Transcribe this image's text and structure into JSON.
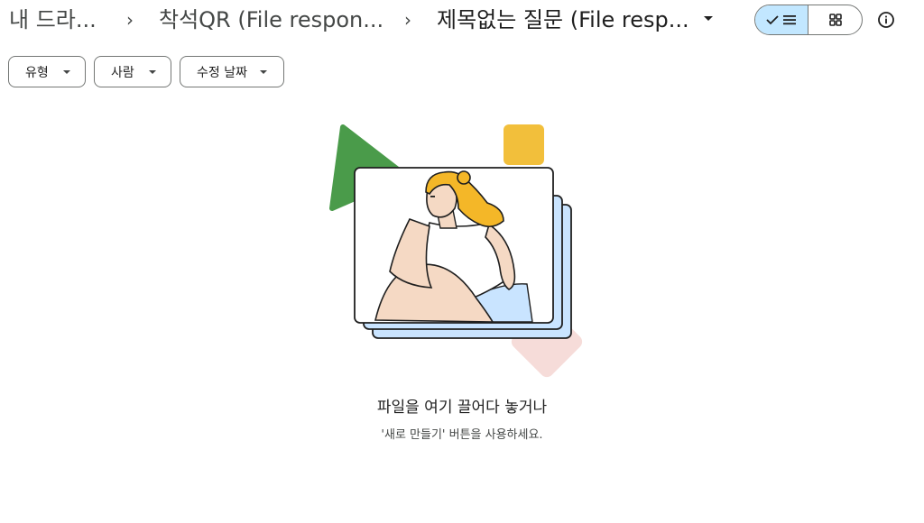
{
  "breadcrumb": {
    "items": [
      "내 드라...",
      "착석QR (File respon...",
      "제목없는 질문 (File resp..."
    ],
    "separator": "›"
  },
  "view_toggle": {
    "active": "list",
    "icons": [
      "check-icon",
      "list-icon",
      "grid-icon"
    ]
  },
  "filters": [
    "유형",
    "사람",
    "수정 날짜"
  ],
  "empty_state": {
    "title": "파일을 여기 끌어다 놓거나",
    "subtitle": "'새로 만들기' 버튼을 사용하세요."
  },
  "colors": {
    "active_segment": "#c2e7ff",
    "green_shape": "#4a9b4a",
    "yellow_shape": "#f2bf3b",
    "pink_shape": "#f6dcd9",
    "blue_card": "#c9e4ff",
    "hair": "#f4b728",
    "skin": "#f5d9c4"
  }
}
